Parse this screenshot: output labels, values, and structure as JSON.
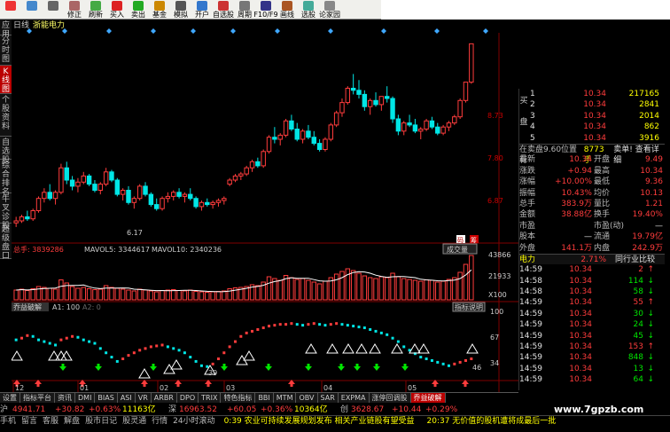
{
  "toolbar": [
    {
      "icon": "home-icon",
      "label": "",
      "color": "#e33"
    },
    {
      "icon": "grid-icon",
      "label": "",
      "color": "#48c"
    },
    {
      "icon": "gear-icon",
      "label": "",
      "color": "#666"
    },
    {
      "icon": "edit-icon",
      "label": "修正",
      "color": "#a66"
    },
    {
      "icon": "refresh-icon",
      "label": "刷新",
      "color": "#4a4"
    },
    {
      "icon": "buy-icon",
      "label": "买入",
      "color": "#d22"
    },
    {
      "icon": "sell-icon",
      "label": "卖出",
      "color": "#2a2"
    },
    {
      "icon": "fund-icon",
      "label": "基金",
      "color": "#c80"
    },
    {
      "icon": "simulate-icon",
      "label": "模拟",
      "color": "#555"
    },
    {
      "icon": "open-account-icon",
      "label": "开户",
      "color": "#37c"
    },
    {
      "icon": "watchlist-icon",
      "label": "自选股",
      "color": "#c33"
    },
    {
      "icon": "cycle-icon",
      "label": "周期",
      "color": "#777"
    },
    {
      "icon": "f10-icon",
      "label": "F10/F9",
      "color": "#338"
    },
    {
      "icon": "draw-icon",
      "label": "画线",
      "color": "#a52"
    },
    {
      "icon": "stock-select-icon",
      "label": "选股",
      "color": "#4a9"
    },
    {
      "icon": "forum-icon",
      "label": "论家园",
      "color": "#888"
    }
  ],
  "sidetabs": [
    {
      "label": "应用",
      "active": false
    },
    {
      "label": "分时图",
      "active": false
    },
    {
      "label": "K线图",
      "active": true
    },
    {
      "label": "个股资料",
      "active": false
    },
    {
      "label": "自选股",
      "active": false
    },
    {
      "label": "综合排名",
      "active": false
    },
    {
      "label": "牛叉诊股",
      "active": false
    },
    {
      "label": "超级盘口",
      "active": false
    }
  ],
  "chart": {
    "period": "日线",
    "stock_name": "浙能电力",
    "price_ticks": [
      "8.73",
      "7.80",
      "6.87"
    ],
    "low_marker": "6.17",
    "buy_tag": "码",
    "sell_tag": "筹",
    "volume_label": "总手: 3839286",
    "ma5_label": "MAVOL5: 3344617",
    "ma10_label": "MAVOL10: 2340236",
    "volume_button": "成交量",
    "volume_ticks": [
      "43866",
      "21933",
      "X100"
    ],
    "indicator_title": "乔益破解",
    "indicator_a1": "A1: 100",
    "indicator_a2": "A2: 0",
    "indicator_button": "指标说明",
    "indicator_ticks": [
      "100",
      "67",
      "34"
    ],
    "indicator_markers": [
      "39",
      "46"
    ],
    "months": [
      "12",
      "01",
      "02",
      "03",
      "04",
      "05"
    ]
  },
  "quote": {
    "ask_side": "卖盘",
    "bid_side": "买盘",
    "asks": [
      {
        "lvl": "5",
        "price": "10.34",
        "vol": "3916"
      },
      {
        "lvl": "4",
        "price": "10.34",
        "vol": "862"
      },
      {
        "lvl": "3",
        "price": "10.34",
        "vol": "2014"
      },
      {
        "lvl": "2",
        "price": "10.34",
        "vol": "2841"
      },
      {
        "lvl": "1",
        "price": "10.34",
        "vol": "217165"
      }
    ],
    "bids": [],
    "position_text": "在卖盘9.60位置有",
    "position_vol": "8773手",
    "position_action": "卖单! 查看详细",
    "stats": [
      {
        "k1": "最新",
        "v1": "10.34",
        "k2": "开盘",
        "v2": "9.49"
      },
      {
        "k1": "涨跌",
        "v1": "+0.94",
        "k2": "最高",
        "v2": "10.34"
      },
      {
        "k1": "涨幅",
        "v1": "+10.00%",
        "k2": "最低",
        "v2": "9.36"
      },
      {
        "k1": "振幅",
        "v1": "10.43%",
        "k2": "均价",
        "v2": "10.13"
      },
      {
        "k1": "总手",
        "v1": "383.9万",
        "k2": "量比",
        "v2": "1.21"
      },
      {
        "k1": "金额",
        "v1": "38.88亿",
        "k2": "换手",
        "v2": "19.40%"
      },
      {
        "k1": "市盈",
        "v1": "",
        "k2": "市盈(动)",
        "v2": "—"
      },
      {
        "k1": "股本",
        "v1": "—",
        "k2": "流通",
        "v2": "19.79亿"
      },
      {
        "k1": "外盘",
        "v1": "141.1万",
        "k2": "内盘",
        "v2": "242.9万"
      }
    ],
    "industry_name": "电力",
    "industry_change": "2.71%",
    "industry_link": "同行业比较",
    "ticks": [
      {
        "time": "14:59",
        "price": "10.34",
        "vol": "2",
        "dir": "red"
      },
      {
        "time": "14:58",
        "price": "10.34",
        "vol": "114",
        "dir": "green"
      },
      {
        "time": "14:58",
        "price": "10.34",
        "vol": "58",
        "dir": "green"
      },
      {
        "time": "14:59",
        "price": "10.34",
        "vol": "55",
        "dir": "red"
      },
      {
        "time": "14:59",
        "price": "10.34",
        "vol": "30",
        "dir": "green"
      },
      {
        "time": "14:59",
        "price": "10.34",
        "vol": "24",
        "dir": "green"
      },
      {
        "time": "14:59",
        "price": "10.34",
        "vol": "45",
        "dir": "green"
      },
      {
        "time": "14:59",
        "price": "10.34",
        "vol": "153",
        "dir": "red"
      },
      {
        "time": "14:59",
        "price": "10.34",
        "vol": "848",
        "dir": "green"
      },
      {
        "time": "14:59",
        "price": "10.34",
        "vol": "13",
        "dir": "green"
      },
      {
        "time": "14:59",
        "price": "10.34",
        "vol": "64",
        "dir": "green"
      }
    ]
  },
  "bottom_tabs": [
    {
      "label": "设置",
      "active": false
    },
    {
      "label": "指标平台",
      "active": false
    },
    {
      "label": "资讯",
      "active": false
    },
    {
      "label": "DMI",
      "active": false
    },
    {
      "label": "BIAS",
      "active": false
    },
    {
      "label": "ASI",
      "active": false
    },
    {
      "label": "VR",
      "active": false
    },
    {
      "label": "ARBR",
      "active": false
    },
    {
      "label": "DPO",
      "active": false
    },
    {
      "label": "TRIX",
      "active": false
    },
    {
      "label": "特色指标",
      "active": false
    },
    {
      "label": "BBI",
      "active": false
    },
    {
      "label": "MTM",
      "active": false
    },
    {
      "label": "OBV",
      "active": false
    },
    {
      "label": "SAR",
      "active": false
    },
    {
      "label": "EXPMA",
      "active": false
    },
    {
      "label": "涨停回调股",
      "active": false
    },
    {
      "label": "乔益破解",
      "active": true
    }
  ],
  "index_bar": {
    "sh_label": "沪",
    "sh_value": "4941.71",
    "sh_change": "+30.82",
    "sh_pct": "+0.63%",
    "sh_amount": "11163亿",
    "sz_label": "深",
    "sz_value": "16963.52",
    "sz_change": "+60.05",
    "sz_pct": "+0.36%",
    "sz_amount": "10364亿",
    "cy_label": "创",
    "cy_value": "3628.67",
    "cy_change": "+10.44",
    "cy_pct": "+0.29%"
  },
  "status_bar": {
    "items": [
      "手机",
      "留言",
      "客服",
      "解盘",
      "股市日记",
      "股灵通",
      "行情",
      "24小时滚动"
    ],
    "news1": "0:39 农业可持续发展规划发布 相关产业链股有望受益",
    "news2": "20:37 无价值的股机遭将成最后一批"
  },
  "watermark": "www.7gpzb.com",
  "colors": {
    "up": "#ff3c3c",
    "down": "#00e6e6",
    "grid": "#800000",
    "volume_up": "#ff3c3c"
  },
  "chart_data": {
    "type": "candlestick",
    "title": "浙能电力",
    "months": [
      "12",
      "01",
      "02",
      "03",
      "04",
      "05"
    ],
    "price_ticks": [
      8.73,
      7.8,
      6.87
    ],
    "ohlc": [
      [
        5.95,
        6.1,
        5.85,
        6.0
      ],
      [
        6.0,
        6.15,
        5.95,
        6.1
      ],
      [
        6.1,
        6.25,
        6.0,
        6.05
      ],
      [
        6.05,
        6.3,
        6.0,
        6.25
      ],
      [
        6.25,
        6.6,
        6.2,
        6.55
      ],
      [
        6.55,
        6.8,
        6.45,
        6.7
      ],
      [
        6.7,
        6.9,
        6.5,
        6.55
      ],
      [
        6.55,
        6.75,
        6.4,
        6.7
      ],
      [
        6.7,
        7.4,
        6.65,
        7.3
      ],
      [
        7.3,
        7.45,
        6.9,
        7.0
      ],
      [
        7.0,
        7.1,
        6.75,
        6.85
      ],
      [
        6.85,
        7.05,
        6.7,
        6.95
      ],
      [
        6.95,
        7.2,
        6.9,
        7.1
      ],
      [
        7.1,
        7.15,
        6.85,
        6.9
      ],
      [
        6.9,
        7.0,
        6.7,
        6.75
      ],
      [
        6.75,
        6.95,
        6.65,
        6.9
      ],
      [
        6.9,
        7.3,
        6.85,
        7.2
      ],
      [
        7.2,
        7.25,
        6.95,
        7.0
      ],
      [
        7.0,
        7.05,
        6.6,
        6.65
      ],
      [
        6.65,
        6.8,
        6.5,
        6.75
      ],
      [
        6.75,
        6.85,
        6.4,
        6.45
      ],
      [
        6.45,
        6.6,
        6.3,
        6.55
      ],
      [
        6.55,
        6.9,
        6.5,
        6.85
      ],
      [
        6.85,
        6.95,
        6.6,
        6.65
      ],
      [
        6.65,
        6.7,
        6.35,
        6.4
      ],
      [
        6.4,
        6.55,
        6.25,
        6.3
      ],
      [
        6.3,
        6.6,
        6.25,
        6.55
      ],
      [
        6.55,
        6.7,
        6.45,
        6.6
      ],
      [
        6.6,
        6.75,
        6.5,
        6.7
      ],
      [
        6.7,
        6.8,
        6.55,
        6.6
      ],
      [
        6.6,
        6.7,
        6.45,
        6.65
      ],
      [
        6.65,
        6.8,
        6.5,
        6.55
      ],
      [
        6.55,
        6.6,
        6.3,
        6.35
      ],
      [
        6.35,
        6.5,
        6.25,
        6.45
      ],
      [
        6.45,
        6.55,
        6.35,
        6.4
      ],
      [
        6.4,
        6.5,
        6.3,
        6.45
      ],
      [
        6.45,
        6.55,
        6.35,
        6.5
      ],
      [
        6.5,
        6.6,
        6.4,
        6.55
      ],
      [
        6.9,
        7.05,
        6.85,
        7.0
      ],
      [
        7.0,
        7.15,
        6.95,
        7.1
      ],
      [
        7.1,
        7.2,
        7.0,
        7.15
      ],
      [
        7.15,
        7.35,
        7.1,
        7.3
      ],
      [
        7.3,
        7.5,
        7.2,
        7.45
      ],
      [
        7.45,
        7.55,
        7.3,
        7.35
      ],
      [
        7.35,
        7.75,
        7.3,
        7.7
      ],
      [
        7.7,
        8.1,
        7.65,
        8.05
      ],
      [
        8.05,
        8.3,
        7.9,
        8.0
      ],
      [
        8.0,
        8.15,
        7.85,
        8.1
      ],
      [
        8.1,
        8.5,
        8.05,
        8.45
      ],
      [
        8.45,
        8.6,
        8.2,
        8.25
      ],
      [
        8.25,
        8.4,
        7.95,
        8.0
      ],
      [
        8.0,
        8.25,
        7.9,
        8.2
      ],
      [
        8.2,
        8.35,
        8.0,
        8.05
      ],
      [
        8.05,
        8.2,
        7.85,
        7.9
      ],
      [
        7.9,
        8.0,
        7.7,
        7.75
      ],
      [
        7.75,
        8.05,
        7.7,
        8.0
      ],
      [
        8.0,
        8.4,
        7.95,
        8.35
      ],
      [
        8.35,
        8.7,
        8.3,
        8.65
      ],
      [
        8.65,
        9.0,
        8.55,
        8.9
      ],
      [
        8.9,
        9.3,
        8.85,
        9.25
      ],
      [
        9.25,
        9.6,
        9.1,
        9.2
      ],
      [
        9.2,
        9.45,
        9.0,
        9.1
      ],
      [
        9.1,
        9.2,
        8.7,
        8.8
      ],
      [
        8.8,
        9.0,
        8.6,
        8.95
      ],
      [
        8.95,
        9.15,
        8.8,
        8.85
      ],
      [
        8.85,
        9.0,
        8.7,
        9.05
      ],
      [
        9.05,
        9.3,
        8.9,
        9.0
      ],
      [
        9.0,
        9.05,
        8.4,
        8.5
      ],
      [
        8.5,
        8.6,
        8.1,
        8.2
      ],
      [
        8.2,
        8.45,
        8.1,
        8.4
      ],
      [
        8.4,
        8.6,
        8.3,
        8.35
      ],
      [
        8.35,
        8.5,
        8.15,
        8.2
      ],
      [
        8.2,
        8.3,
        8.0,
        8.25
      ],
      [
        8.25,
        8.5,
        8.2,
        8.45
      ],
      [
        8.45,
        8.55,
        8.25,
        8.3
      ],
      [
        8.3,
        8.4,
        8.1,
        8.15
      ],
      [
        8.15,
        8.35,
        8.1,
        8.3
      ],
      [
        8.3,
        8.45,
        8.2,
        8.4
      ],
      [
        8.4,
        8.6,
        8.35,
        8.55
      ],
      [
        8.55,
        9.0,
        8.5,
        8.95
      ],
      [
        8.95,
        9.4,
        8.9,
        9.4
      ],
      [
        9.4,
        10.34,
        9.36,
        10.34
      ]
    ],
    "volume": [
      22,
      24,
      21,
      25,
      30,
      28,
      26,
      24,
      45,
      38,
      30,
      26,
      28,
      25,
      23,
      24,
      32,
      28,
      26,
      24,
      22,
      20,
      24,
      22,
      20,
      18,
      21,
      22,
      23,
      21,
      20,
      22,
      19,
      18,
      17,
      18,
      19,
      20,
      25,
      27,
      28,
      30,
      34,
      32,
      40,
      52,
      48,
      44,
      55,
      50,
      46,
      48,
      44,
      40,
      36,
      42,
      50,
      58,
      64,
      70,
      66,
      60,
      54,
      50,
      48,
      52,
      50,
      60,
      52,
      48,
      46,
      44,
      42,
      45,
      44,
      40,
      42,
      46,
      50,
      62,
      80,
      100
    ],
    "indicator": [
      70,
      72,
      75,
      74,
      70,
      68,
      66,
      64,
      70,
      72,
      74,
      73,
      70,
      68,
      66,
      60,
      55,
      50,
      45,
      48,
      52,
      55,
      58,
      60,
      62,
      63,
      64,
      62,
      60,
      58,
      55,
      50,
      45,
      40,
      39,
      42,
      48,
      55,
      62,
      68,
      74,
      78,
      80,
      82,
      84,
      86,
      87,
      88,
      88,
      89,
      88,
      87,
      88,
      89,
      88,
      87,
      88,
      89,
      88,
      87,
      86,
      85,
      84,
      82,
      80,
      78,
      76,
      72,
      68,
      62,
      58,
      54,
      50,
      48,
      46,
      44,
      42,
      40,
      42,
      44,
      46,
      48
    ],
    "ylim": [
      5.5,
      10.5
    ]
  }
}
